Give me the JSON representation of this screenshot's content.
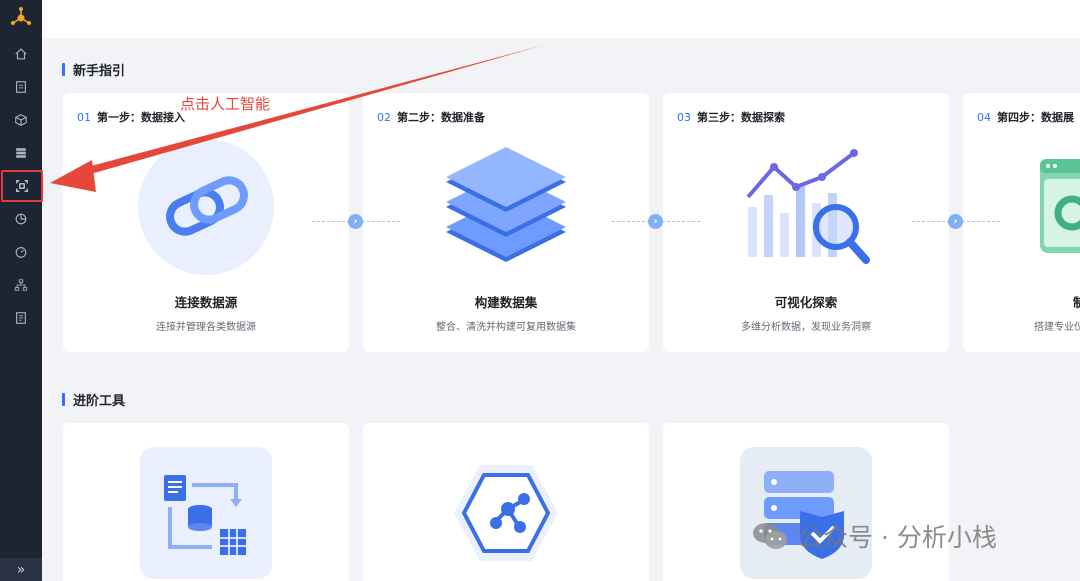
{
  "sections": {
    "guide_title": "新手指引",
    "advanced_title": "进阶工具"
  },
  "steps": [
    {
      "num": "01",
      "label": "第一步：数据接入",
      "title": "连接数据源",
      "desc": "连接并管理各类数据源"
    },
    {
      "num": "02",
      "label": "第二步：数据准备",
      "title": "构建数据集",
      "desc": "整合、清洗并构建可复用数据集"
    },
    {
      "num": "03",
      "label": "第三步：数据探索",
      "title": "可视化探索",
      "desc": "多维分析数据，发现业务洞察"
    },
    {
      "num": "04",
      "label": "第四步：数据展",
      "title": "制",
      "desc": "搭建专业仪"
    }
  ],
  "annotation": "点击人工智能",
  "watermark": "公众号 · 分析小栈",
  "sidebar": {
    "collapse_glyph": "»",
    "items": [
      "home-icon",
      "document-icon",
      "cube-icon",
      "database-icon",
      "ai-icon",
      "pie-chart-icon",
      "dashboard-icon",
      "hierarchy-icon",
      "report-icon"
    ]
  },
  "connector_glyph": "›",
  "colors": {
    "accent": "#3370ff",
    "sidebar": "#1d2433",
    "annotation": "#e5473b"
  }
}
